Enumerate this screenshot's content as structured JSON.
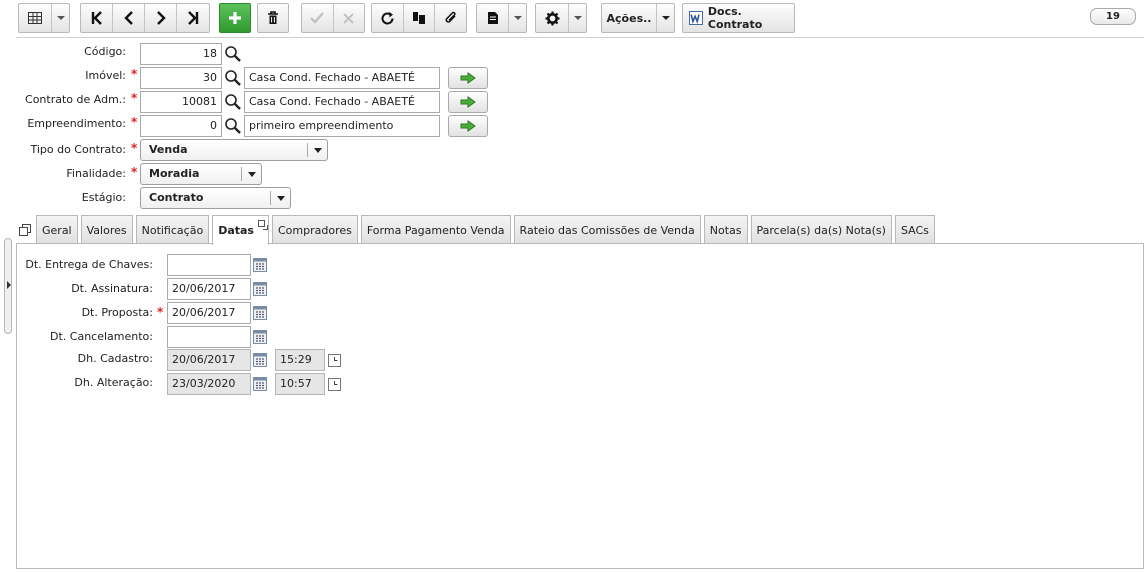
{
  "toolbar": {
    "acoes_label": "Ações..",
    "docs_label": "Docs. Contrato",
    "record_count": "19"
  },
  "form": {
    "codigo": {
      "label": "Código:",
      "value": "18"
    },
    "imovel": {
      "label": "Imóvel:",
      "value": "30",
      "description": "Casa Cond. Fechado - ABAETÉ"
    },
    "contrato_adm": {
      "label": "Contrato de Adm.:",
      "value": "10081",
      "description": "Casa Cond. Fechado - ABAETÉ"
    },
    "empreendimento": {
      "label": "Empreendimento:",
      "value": "0",
      "description": "primeiro empreendimento"
    },
    "tipo_contrato": {
      "label": "Tipo do Contrato:",
      "value": "Venda"
    },
    "finalidade": {
      "label": "Finalidade:",
      "value": "Moradia"
    },
    "estagio": {
      "label": "Estágio:",
      "value": "Contrato"
    },
    "required_mark": "*"
  },
  "tabs": [
    {
      "label": "Geral"
    },
    {
      "label": "Valores"
    },
    {
      "label": "Notificação"
    },
    {
      "label": "Datas",
      "active": true
    },
    {
      "label": "Compradores"
    },
    {
      "label": "Forma Pagamento Venda"
    },
    {
      "label": "Rateio das Comissões de Venda"
    },
    {
      "label": "Notas"
    },
    {
      "label": "Parcela(s) da(s) Nota(s)"
    },
    {
      "label": "SACs"
    }
  ],
  "datas": {
    "entrega_chaves": {
      "label": "Dt. Entrega de Chaves:",
      "value": ""
    },
    "assinatura": {
      "label": "Dt. Assinatura:",
      "value": "20/06/2017"
    },
    "proposta": {
      "label": "Dt. Proposta:",
      "value": "20/06/2017"
    },
    "cancelamento": {
      "label": "Dt. Cancelamento:",
      "value": ""
    },
    "cadastro": {
      "label": "Dh. Cadastro:",
      "date": "20/06/2017",
      "time": "15:29"
    },
    "alteracao": {
      "label": "Dh. Alteração:",
      "date": "23/03/2020",
      "time": "10:57"
    }
  },
  "colors": {
    "accent_green": "#3aa53a",
    "required_red": "#d22222",
    "word_blue": "#2b579a"
  },
  "icons": [
    "grid-icon",
    "first-icon",
    "prev-icon",
    "next-icon",
    "last-icon",
    "add-icon",
    "delete-icon",
    "confirm-icon",
    "cancel-icon",
    "refresh-icon",
    "copy-icon",
    "attach-icon",
    "report-icon",
    "settings-icon",
    "word-icon",
    "search-icon",
    "arrow-right-icon",
    "calendar-icon",
    "clock-icon"
  ]
}
